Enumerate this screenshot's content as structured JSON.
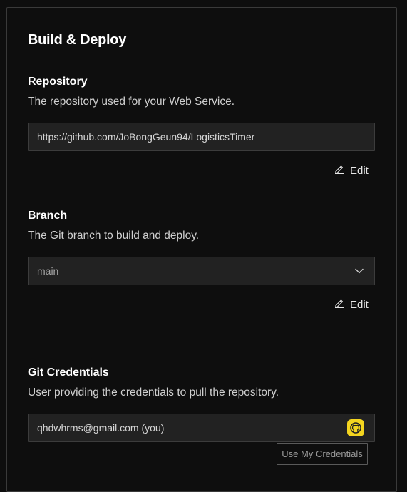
{
  "page": {
    "title": "Build & Deploy"
  },
  "repository": {
    "title": "Repository",
    "description": "The repository used for your Web Service.",
    "value": "https://github.com/JoBongGeun94/LogisticsTimer",
    "edit_label": "Edit"
  },
  "branch": {
    "title": "Branch",
    "description": "The Git branch to build and deploy.",
    "selected": "main",
    "edit_label": "Edit"
  },
  "credentials": {
    "title": "Git Credentials",
    "description": "User providing the credentials to pull the repository.",
    "value": "qhdwhrms@gmail.com (you)",
    "avatar_color": "#f4d51f",
    "button_label": "Use My Credentials"
  },
  "icons": {
    "edit": "pencil-icon",
    "dropdown": "chevron-down-icon",
    "avatar": "github-avatar-icon"
  }
}
